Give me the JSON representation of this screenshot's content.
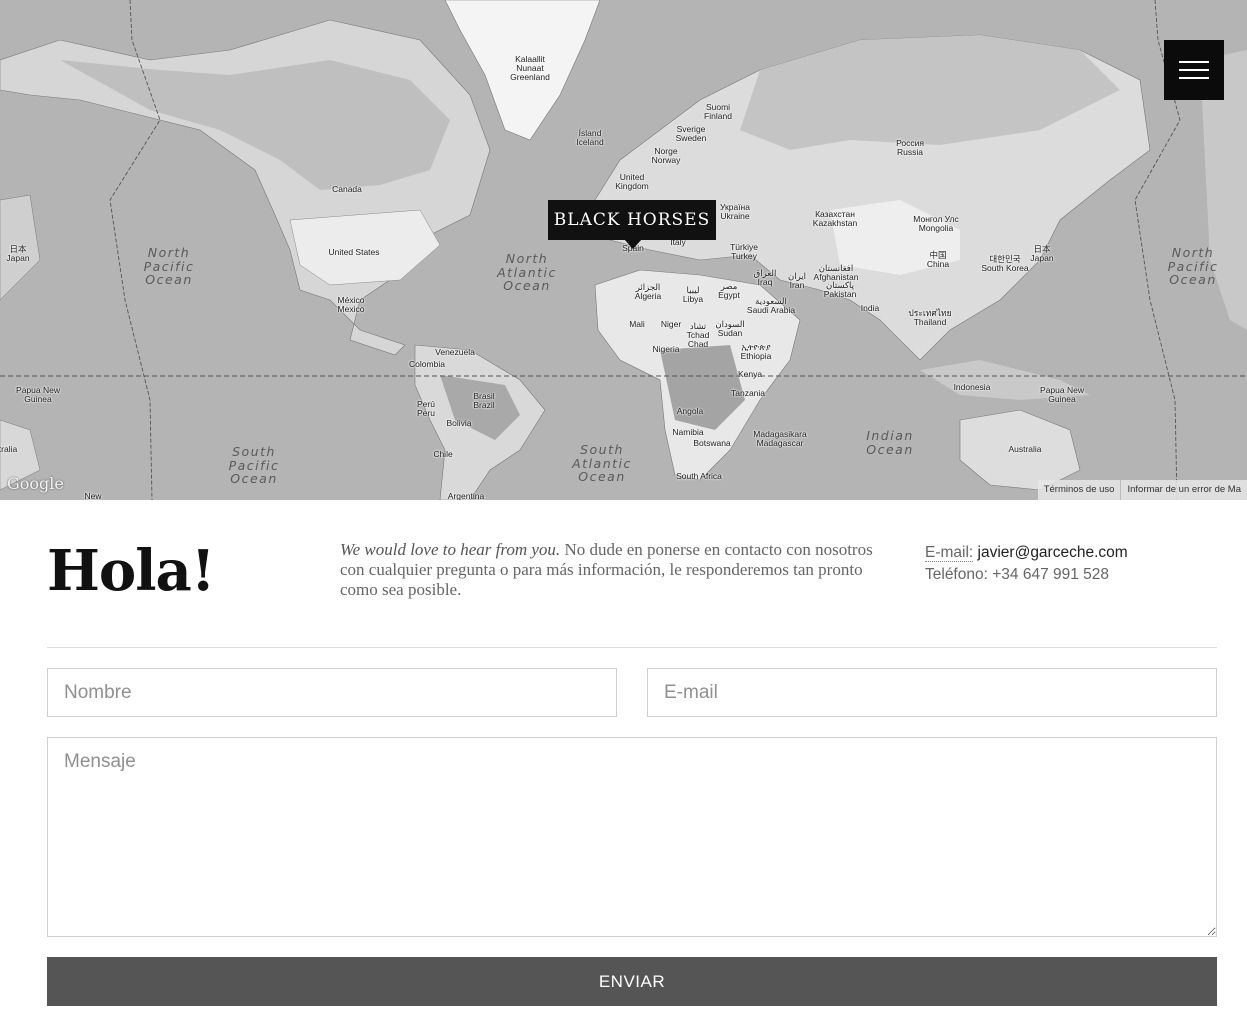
{
  "map": {
    "marker_label": "BLACK HORSES",
    "google_logo": "Google",
    "footer": {
      "terms": "Términos de uso",
      "report": "Informar de un error de Ma"
    },
    "countries": [
      {
        "text": "Kalaallit\nNunaat\nGreenland"
      },
      {
        "text": "Ísland\nIceland"
      },
      {
        "text": "Suomi\nFinland"
      },
      {
        "text": "Sverige\nSweden"
      },
      {
        "text": "Norge\nNorway"
      },
      {
        "text": "United\nKingdom"
      },
      {
        "text": "Россия\nRussia"
      },
      {
        "text": "Canada"
      },
      {
        "text": "United States"
      },
      {
        "text": "Україна\nUkraine"
      },
      {
        "text": "Казахстан\nKazakhstan"
      },
      {
        "text": "Монгол Улс\nMongolia"
      },
      {
        "text": "Italy"
      },
      {
        "text": "Spain"
      },
      {
        "text": "Türkiye\nTurkey"
      },
      {
        "text": "العراق\nIraq"
      },
      {
        "text": "ایران\nIran"
      },
      {
        "text": "افغانستان\nAfghanistan"
      },
      {
        "text": "پاکستان\nPakistan"
      },
      {
        "text": "中国\nChina"
      },
      {
        "text": "대한민국\nSouth Korea"
      },
      {
        "text": "日本\nJapan"
      },
      {
        "text": "日本\nJapan"
      },
      {
        "text": "México\nMexico"
      },
      {
        "text": "الجزائر\nAlgeria"
      },
      {
        "text": "ليبيا\nLibya"
      },
      {
        "text": "مصر\nEgypt"
      },
      {
        "text": "السعودية\nSaudi Arabia"
      },
      {
        "text": "India"
      },
      {
        "text": "ประเทศไทย\nThailand"
      },
      {
        "text": "Mali"
      },
      {
        "text": "Niger"
      },
      {
        "text": "تشاد\nTchad\nChad"
      },
      {
        "text": "السودان\nSudan"
      },
      {
        "text": "ኢትዮጵያ\nEthiopia"
      },
      {
        "text": "Nigeria"
      },
      {
        "text": "Venezuela"
      },
      {
        "text": "Colombia"
      },
      {
        "text": "Kenya"
      },
      {
        "text": "Tanzania"
      },
      {
        "text": "Indonesia"
      },
      {
        "text": "Papua New\nGuinea"
      },
      {
        "text": "Papua New\nGuinea"
      },
      {
        "text": "Perú\nPeru"
      },
      {
        "text": "Brasil\nBrazil"
      },
      {
        "text": "Bolivia"
      },
      {
        "text": "Angola"
      },
      {
        "text": "Namibia"
      },
      {
        "text": "Botswana"
      },
      {
        "text": "Madagasikara\nMadagascar"
      },
      {
        "text": "Chile"
      },
      {
        "text": "South Africa"
      },
      {
        "text": "Australia"
      },
      {
        "text": "tralia"
      },
      {
        "text": "Argentina"
      },
      {
        "text": "New"
      }
    ],
    "oceans": [
      {
        "text": "North\nPacific\nOcean"
      },
      {
        "text": "North\nAtlantic\nOcean"
      },
      {
        "text": "North\nPacific\nOcean"
      },
      {
        "text": "South\nPacific\nOcean"
      },
      {
        "text": "South\nAtlantic\nOcean"
      },
      {
        "text": "Indian\nOcean"
      }
    ]
  },
  "menu": {
    "icon": "hamburger-menu-icon"
  },
  "contact": {
    "heading": "Hola!",
    "intro_italic": "We would love to hear from you.",
    "intro_text": " No dude en ponerse en contacto con nosotros con cualquier pregunta o para más información, le responderemos tan pronto como sea posible.",
    "email_label": "E-mail:",
    "email_value": " javier@garceche.com",
    "phone_label": "Teléfono:",
    "phone_value": " +34 647 991 528"
  },
  "form": {
    "name_placeholder": "Nombre",
    "email_placeholder": "E-mail",
    "message_placeholder": "Mensaje",
    "submit_label": "ENVIAR"
  }
}
